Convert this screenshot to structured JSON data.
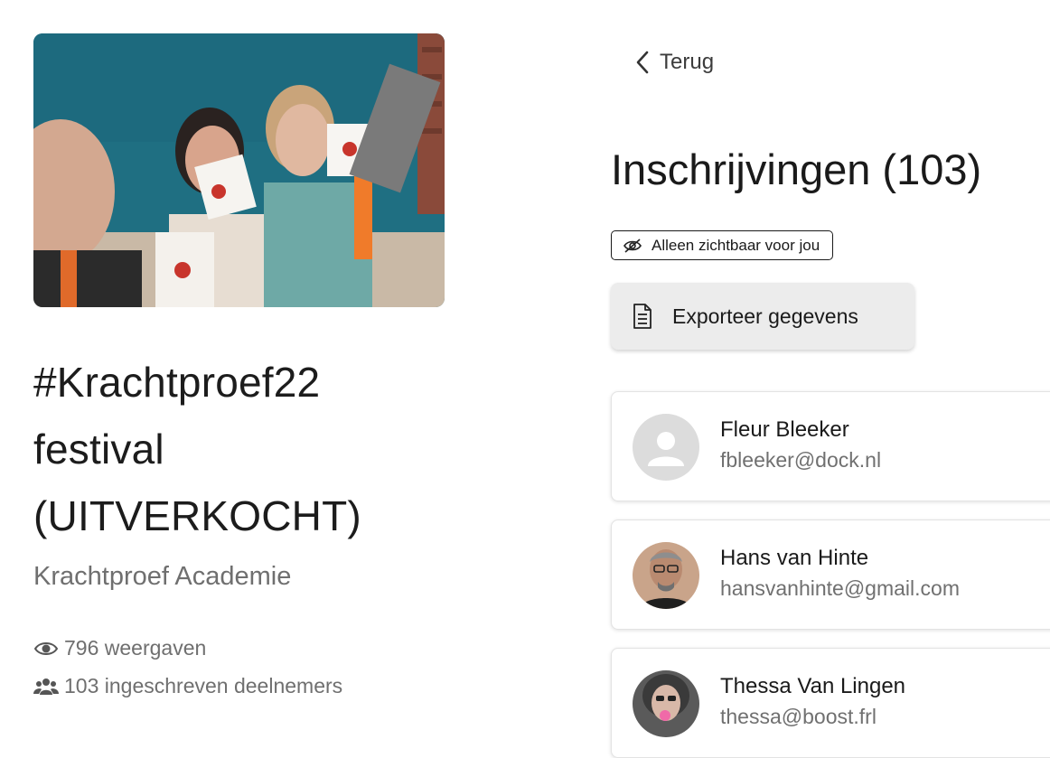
{
  "event": {
    "title_line1": "#Krachtproef22",
    "title_line2": "festival",
    "title_line3": "(UITVERKOCHT)",
    "organizer": "Krachtproef Academie",
    "views": "796 weergaven",
    "registrations": "103 ingeschreven deelnemers"
  },
  "panel": {
    "back_label": "Terug",
    "title": "Inschrijvingen (103)",
    "visibility_label": "Alleen zichtbaar voor jou",
    "export_label": "Exporteer gegevens"
  },
  "registrants": [
    {
      "name": "Fleur Bleeker",
      "email": "fbleeker@dock.nl",
      "avatar": "default-avatar-icon"
    },
    {
      "name": "Hans van Hinte",
      "email": "hansvanhinte@gmail.com",
      "avatar": "photo"
    },
    {
      "name": "Thessa Van Lingen",
      "email": "thessa@boost.frl",
      "avatar": "photo"
    }
  ],
  "icons": {
    "back": "chevron-left-icon",
    "views": "eye-icon",
    "registrations": "users-icon",
    "visibility": "eye-slash-icon",
    "export": "document-icon"
  },
  "colors": {
    "text_primary": "#1a1a1a",
    "text_secondary": "#6f6f6f",
    "button_bg": "#ececec",
    "card_border": "#e3e3e3"
  }
}
